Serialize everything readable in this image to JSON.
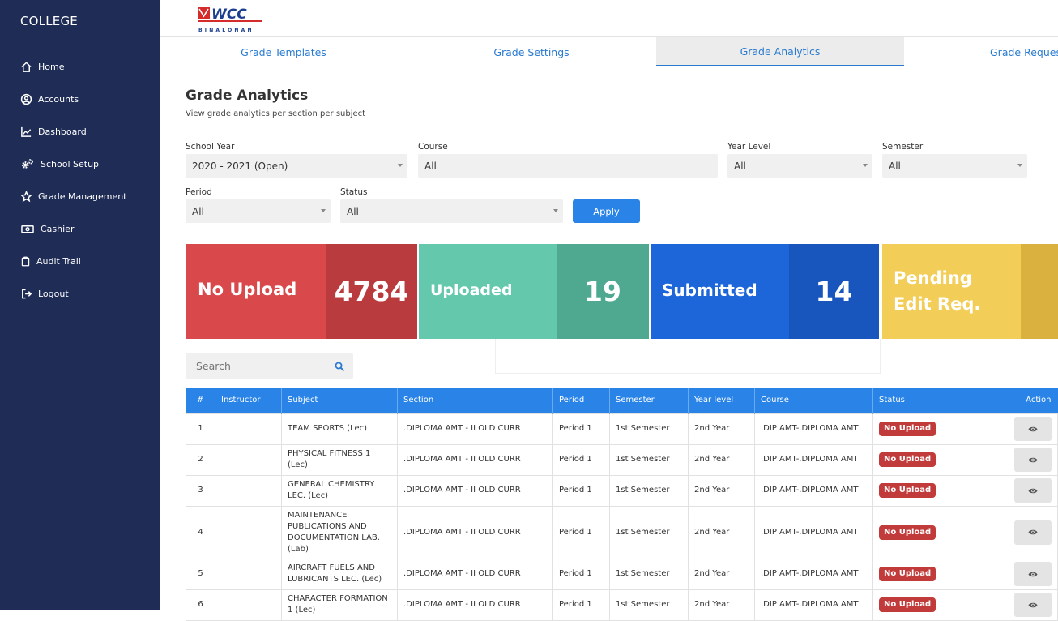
{
  "sidebar": {
    "brand": "COLLEGE",
    "items": [
      {
        "label": "Home",
        "icon": "home-icon"
      },
      {
        "label": "Accounts",
        "icon": "user-circle-icon"
      },
      {
        "label": "Dashboard",
        "icon": "chart-line-icon"
      },
      {
        "label": "School Setup",
        "icon": "cogs-icon"
      },
      {
        "label": "Grade Management",
        "icon": "star-icon"
      },
      {
        "label": "Cashier",
        "icon": "money-icon"
      },
      {
        "label": "Audit Trail",
        "icon": "clipboard-icon"
      },
      {
        "label": "Logout",
        "icon": "logout-icon"
      }
    ]
  },
  "logo": {
    "text": "WCC",
    "sub": "BINALONAN"
  },
  "tabs": [
    {
      "label": "Grade Templates",
      "active": false
    },
    {
      "label": "Grade Settings",
      "active": false
    },
    {
      "label": "Grade Analytics",
      "active": true
    },
    {
      "label": "Grade Reques",
      "active": false
    }
  ],
  "page": {
    "title": "Grade Analytics",
    "subtitle": "View grade analytics per section per subject"
  },
  "filters": {
    "school_year": {
      "label": "School Year",
      "value": "2020 - 2021 (Open)"
    },
    "course": {
      "label": "Course",
      "value": "All"
    },
    "year_level": {
      "label": "Year Level",
      "value": "All"
    },
    "semester": {
      "label": "Semester",
      "value": "All"
    },
    "period": {
      "label": "Period",
      "value": "All"
    },
    "status": {
      "label": "Status",
      "value": "All"
    },
    "apply_label": "Apply"
  },
  "cards": [
    {
      "label": "No Upload",
      "value": "4784",
      "color": "#d9484b",
      "dark": "#b93b3d"
    },
    {
      "label": "Uploaded",
      "value": "19",
      "color": "#63c8ac",
      "dark": "#4fa890"
    },
    {
      "label": "Submitted",
      "value": "14",
      "color": "#1d66d9",
      "dark": "#1856bd"
    },
    {
      "label": "Pending Edit Req.",
      "value": "",
      "color": "#f2cd57",
      "dark": "#dab13f"
    }
  ],
  "search": {
    "placeholder": "Search"
  },
  "table": {
    "headers": [
      "#",
      "Instructor",
      "Subject",
      "Section",
      "Period",
      "Semester",
      "Year level",
      "Course",
      "Status",
      "Action"
    ],
    "rows": [
      {
        "num": "1",
        "instructor": "",
        "subject": "TEAM SPORTS (Lec)",
        "section": ".DIPLOMA AMT - II OLD CURR",
        "period": "Period 1",
        "semester": "1st Semester",
        "year": "2nd Year",
        "course": ".DIP AMT-.DIPLOMA AMT",
        "status": "No Upload"
      },
      {
        "num": "2",
        "instructor": "",
        "subject": "PHYSICAL FITNESS 1 (Lec)",
        "section": ".DIPLOMA AMT - II OLD CURR",
        "period": "Period 1",
        "semester": "1st Semester",
        "year": "2nd Year",
        "course": ".DIP AMT-.DIPLOMA AMT",
        "status": "No Upload"
      },
      {
        "num": "3",
        "instructor": "",
        "subject": "GENERAL CHEMISTRY LEC. (Lec)",
        "section": ".DIPLOMA AMT - II OLD CURR",
        "period": "Period 1",
        "semester": "1st Semester",
        "year": "2nd Year",
        "course": ".DIP AMT-.DIPLOMA AMT",
        "status": "No Upload"
      },
      {
        "num": "4",
        "instructor": "",
        "subject": "MAINTENANCE PUBLICATIONS AND DOCUMENTATION LAB. (Lab)",
        "section": ".DIPLOMA AMT - II OLD CURR",
        "period": "Period 1",
        "semester": "1st Semester",
        "year": "2nd Year",
        "course": ".DIP AMT-.DIPLOMA AMT",
        "status": "No Upload"
      },
      {
        "num": "5",
        "instructor": "",
        "subject": "AIRCRAFT FUELS AND LUBRICANTS LEC. (Lec)",
        "section": ".DIPLOMA AMT - II OLD CURR",
        "period": "Period 1",
        "semester": "1st Semester",
        "year": "2nd Year",
        "course": ".DIP AMT-.DIPLOMA AMT",
        "status": "No Upload"
      },
      {
        "num": "6",
        "instructor": "",
        "subject": "CHARACTER FORMATION 1 (Lec)",
        "section": ".DIPLOMA AMT - II OLD CURR",
        "period": "Period 1",
        "semester": "1st Semester",
        "year": "2nd Year",
        "course": ".DIP AMT-.DIPLOMA AMT",
        "status": "No Upload"
      }
    ]
  }
}
